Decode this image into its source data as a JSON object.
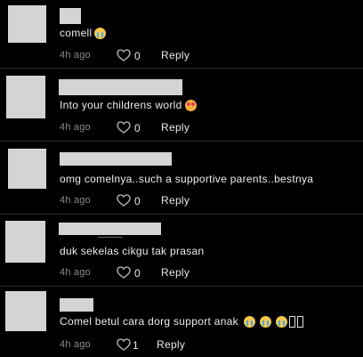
{
  "comments": [
    {
      "text": "comell",
      "emojis": [
        "crying-face"
      ],
      "time": "4h ago",
      "likes": "0",
      "reply_label": "Reply"
    },
    {
      "text": "Into your childrens world",
      "emojis": [
        "smiling-face-with-heart-eyes"
      ],
      "time": "4h ago",
      "likes": "0",
      "reply_label": "Reply"
    },
    {
      "text": "omg comelnya..such a supportive parents..bestnya",
      "emojis": [],
      "time": "4h ago",
      "likes": "0",
      "reply_label": "Reply"
    },
    {
      "text": "duk sekelas cikgu tak prasan",
      "emojis": [],
      "time": "4h ago",
      "likes": "0",
      "reply_label": "Reply"
    },
    {
      "text": "Comel betul cara dorg support anak",
      "emojis": [
        "crying-face",
        "crying-face",
        "crying-face",
        "missing-glyph",
        "missing-glyph"
      ],
      "time": "4h ago",
      "likes": "1",
      "reply_label": "Reply"
    }
  ],
  "colors": {
    "background": "#000000",
    "avatar_placeholder": "#d4d4d4",
    "meta_text": "#8a8a8a",
    "divider": "#2e2e2e"
  }
}
